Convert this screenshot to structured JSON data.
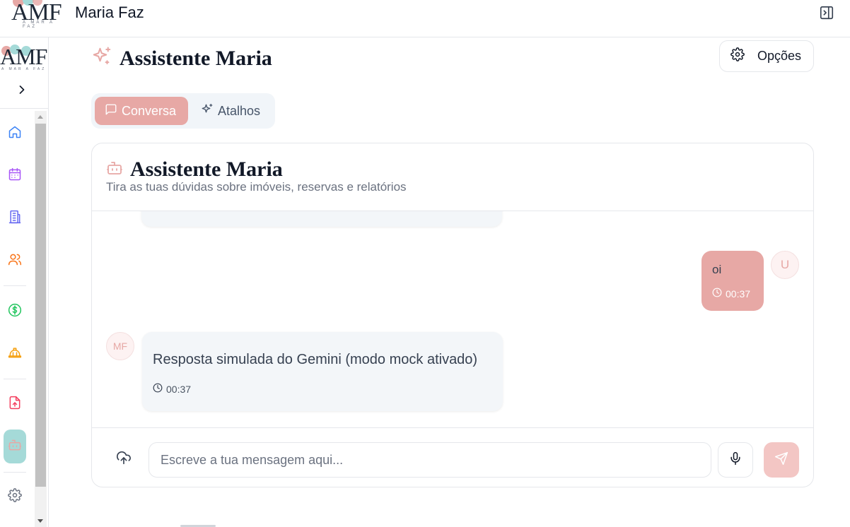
{
  "header": {
    "logo_text": "AMF",
    "logo_sub": "A MAR A FAZ",
    "brand_name": "Maria Faz",
    "panel_toggle_icon": "panel-right-icon"
  },
  "sidebar": {
    "expand_icon": "chevron-right-icon",
    "items": [
      {
        "icon": "home-icon",
        "color": "#3b82f6"
      },
      {
        "icon": "calendar-icon",
        "color": "#a855f7"
      },
      {
        "icon": "building-icon",
        "color": "#6366f1"
      },
      {
        "icon": "users-icon",
        "color": "#f97316"
      },
      {
        "icon": "dollar-icon",
        "color": "#22c55e"
      },
      {
        "icon": "cleaning-icon",
        "color": "#f59e0b"
      },
      {
        "icon": "file-upload-icon",
        "color": "#f43f5e"
      },
      {
        "icon": "bot-icon",
        "color": "#e7a8a5",
        "active": true
      },
      {
        "icon": "settings-icon",
        "color": "#6b7280"
      }
    ]
  },
  "page": {
    "title": "Assistente Maria",
    "title_icon": "sparkles-icon",
    "options_label": "Opções",
    "options_icon": "gear-icon"
  },
  "tabs": [
    {
      "label": "Conversa",
      "icon": "message-square-icon",
      "active": true
    },
    {
      "label": "Atalhos",
      "icon": "sparkles-icon",
      "active": false
    }
  ],
  "chat": {
    "title": "Assistente Maria",
    "subtitle": "Tira as tuas dúvidas sobre imóveis, reservas e relatórios",
    "messages": [
      {
        "role": "user",
        "avatar": "U",
        "text": "oi",
        "time": "00:37"
      },
      {
        "role": "bot",
        "avatar": "MF",
        "text": "Resposta simulada do Gemini (modo mock ativado)",
        "time": "00:37"
      }
    ],
    "input_placeholder": "Escreve a tua mensagem aqui...",
    "input_value": ""
  },
  "colors": {
    "accent": "#e7a8a5",
    "accent_light": "#f3c6c4",
    "active_sidebar": "#a5dad8"
  }
}
